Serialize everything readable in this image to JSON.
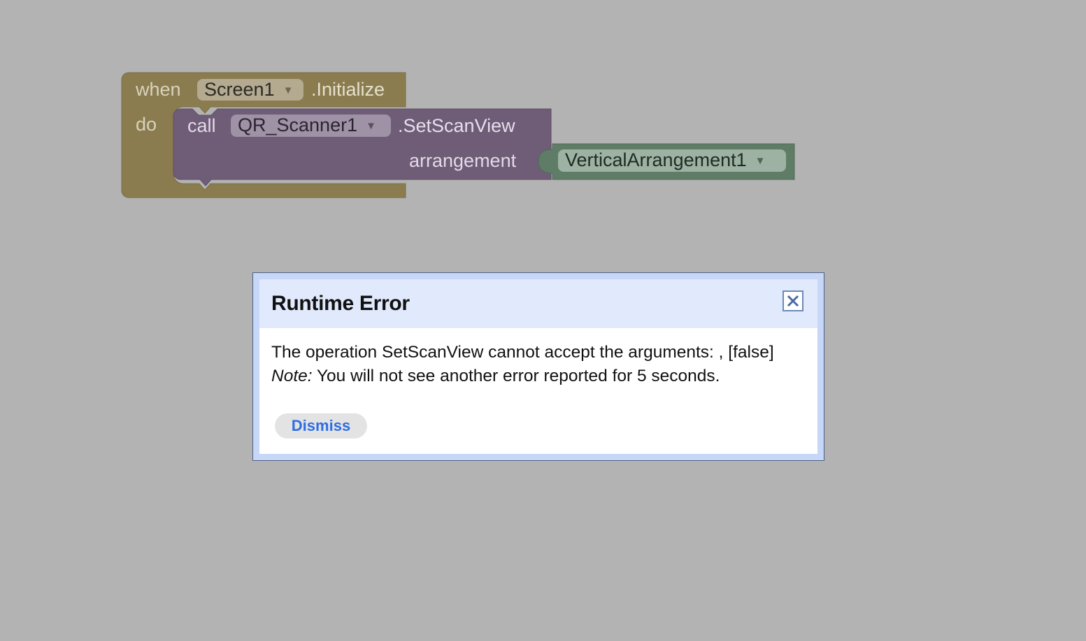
{
  "colors": {
    "workspace_bg": "#b3b3b3",
    "event_block": "#8a7c4f",
    "call_block": "#6f5c77",
    "component_block": "#5f7d66",
    "dialog_border": "#4b6187",
    "dialog_header": "#e1eafc",
    "dismiss_text": "#2d6ee3"
  },
  "event_block": {
    "when_label": "when",
    "component": "Screen1",
    "event": ".Initialize",
    "do_label": "do"
  },
  "call_block": {
    "call_label": "call",
    "component": "QR_Scanner1",
    "method": ".SetScanView",
    "param_label": "arrangement"
  },
  "component_block": {
    "component": "VerticalArrangement1"
  },
  "dropdown_icon": "dropdown-arrow-icon",
  "dialog": {
    "title": "Runtime Error",
    "close_icon": "close-icon",
    "message": "The operation SetScanView cannot accept the arguments: , [false]",
    "note_label": "Note:",
    "note_text": " You will not see another error reported for 5 seconds.",
    "dismiss_label": "Dismiss"
  }
}
